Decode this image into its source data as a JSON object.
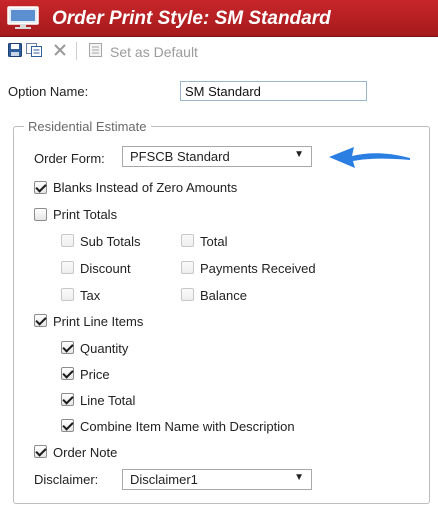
{
  "window": {
    "title": "Order Print Style: SM Standard"
  },
  "toolbar": {
    "icons": [
      "save-icon",
      "copy-icon",
      "delete-icon",
      "set-default-icon"
    ],
    "set_default_label": "Set as Default"
  },
  "option_name": {
    "label": "Option Name:",
    "value": "SM Standard"
  },
  "residential_estimate": {
    "legend": "Residential Estimate",
    "order_form": {
      "label": "Order Form:",
      "selected": "PFSCB Standard"
    },
    "blanks_zero": {
      "label": "Blanks Instead of Zero Amounts",
      "checked": true
    },
    "print_totals": {
      "label": "Print Totals",
      "checked": false,
      "sub_totals": {
        "label": "Sub Totals",
        "checked": false,
        "disabled": true
      },
      "total": {
        "label": "Total",
        "checked": false,
        "disabled": true
      },
      "discount": {
        "label": "Discount",
        "checked": false,
        "disabled": true
      },
      "payments_received": {
        "label": "Payments Received",
        "checked": false,
        "disabled": true
      },
      "tax": {
        "label": "Tax",
        "checked": false,
        "disabled": true
      },
      "balance": {
        "label": "Balance",
        "checked": false,
        "disabled": true
      }
    },
    "print_line_items": {
      "label": "Print Line Items",
      "checked": true,
      "quantity": {
        "label": "Quantity",
        "checked": true
      },
      "price": {
        "label": "Price",
        "checked": true
      },
      "line_total": {
        "label": "Line Total",
        "checked": true
      },
      "combine_item_name": {
        "label": "Combine Item Name with Description",
        "checked": true
      }
    },
    "order_note": {
      "label": "Order Note",
      "checked": true
    },
    "disclaimer": {
      "label": "Disclaimer:",
      "selected": "Disclaimer1"
    }
  },
  "colors": {
    "titlebar": "#b52024",
    "title_text": "#ffffff",
    "annotation_arrow": "#2b7fe3",
    "input_border": "#9cb6cd",
    "fieldset_border": "#bdbdbd"
  }
}
